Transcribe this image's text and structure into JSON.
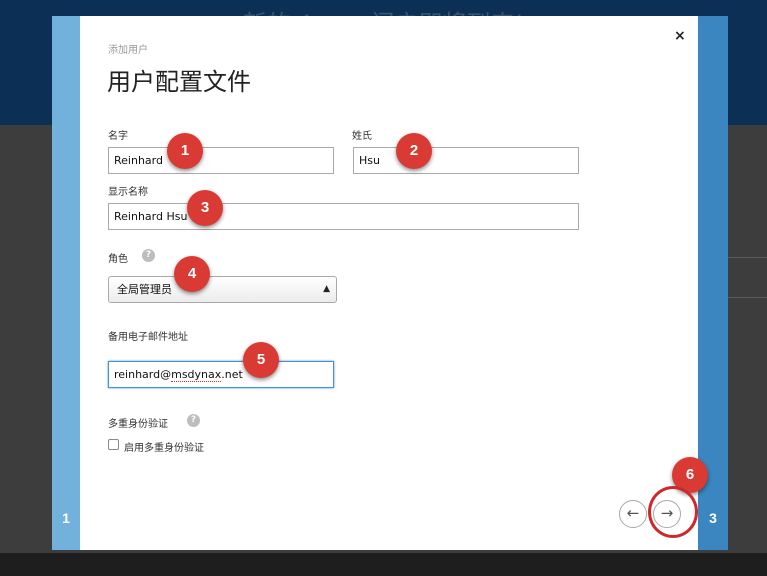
{
  "background": {
    "header_title": "新的 A…… 门户即将到来!",
    "accent_color": "#0b2f55"
  },
  "steps": {
    "left_number": "1",
    "right_number": "3"
  },
  "dialog": {
    "breadcrumb": "添加用户",
    "title": "用户配置文件",
    "close_icon": "×"
  },
  "form": {
    "first_name": {
      "label": "名字",
      "value": "Reinhard"
    },
    "last_name": {
      "label": "姓氏",
      "value": "Hsu"
    },
    "display_name": {
      "label": "显示名称",
      "value": "Reinhard Hsu"
    },
    "role": {
      "label": "角色",
      "selected": "全局管理员",
      "help": "?"
    },
    "alternate_email": {
      "label": "备用电子邮件地址",
      "value_prefix": "reinhard@",
      "value_typo": "msdynax",
      "value_suffix": ".net"
    },
    "mfa": {
      "label": "多重身份验证",
      "help": "?",
      "checkbox_label": "启用多重身份验证",
      "checked": false
    }
  },
  "navigation": {
    "prev_icon": "←",
    "next_icon": "→"
  },
  "annotations": {
    "markers": [
      "1",
      "2",
      "3",
      "4",
      "5",
      "6"
    ],
    "marker_color": "#d93a33"
  }
}
